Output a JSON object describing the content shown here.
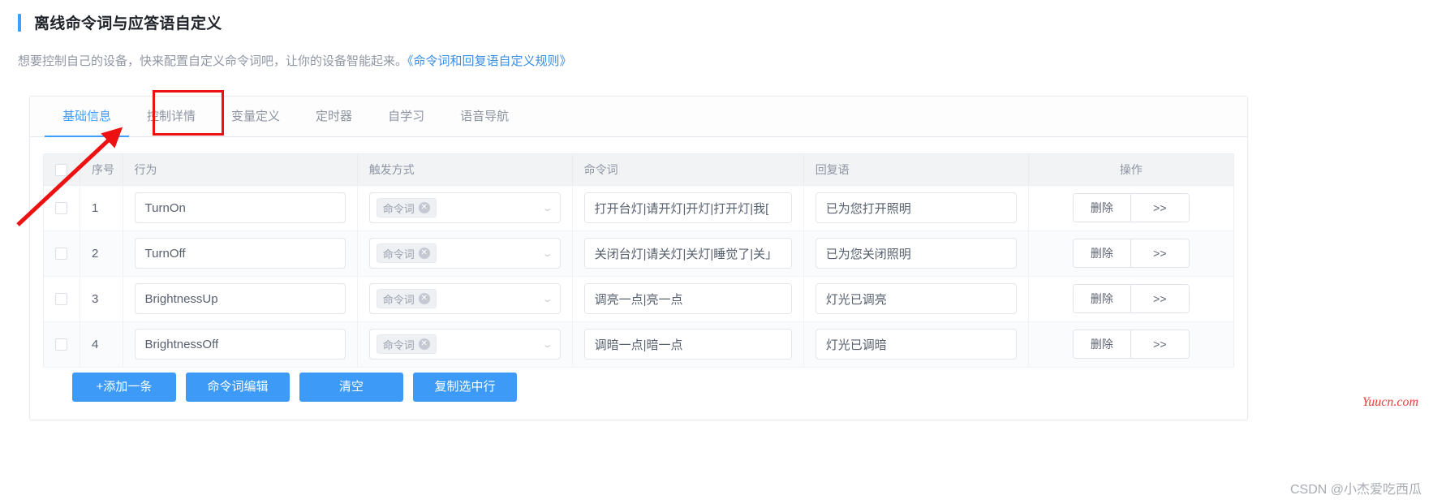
{
  "header": {
    "title": "离线命令词与应答语自定义",
    "description_prefix": "想要控制自己的设备，快来配置自定义命令词吧，让你的设备智能起来。",
    "description_link": "《命令词和回复语自定义规则》",
    "accent_color": "#409eff"
  },
  "tabs": [
    {
      "label": "基础信息",
      "active": true
    },
    {
      "label": "控制详情",
      "active": false
    },
    {
      "label": "变量定义",
      "active": false
    },
    {
      "label": "定时器",
      "active": false
    },
    {
      "label": "自学习",
      "active": false
    },
    {
      "label": "语音导航",
      "active": false
    }
  ],
  "annotation": {
    "color": "#ee1111",
    "target_tab": "控制详情"
  },
  "table": {
    "columns": [
      "",
      "序号",
      "行为",
      "触发方式",
      "命令词",
      "回复语",
      "操作"
    ],
    "rows": [
      {
        "index": "1",
        "action": "TurnOn",
        "trigger_tag": "命令词",
        "command": "打开台灯|请开灯|开灯|打开灯|我[",
        "reply": "已为您打开照明",
        "op_delete": "删除",
        "op_more": ">>"
      },
      {
        "index": "2",
        "action": "TurnOff",
        "trigger_tag": "命令词",
        "command": "关闭台灯|请关灯|关灯|睡觉了|关」",
        "reply": "已为您关闭照明",
        "op_delete": "删除",
        "op_more": ">>"
      },
      {
        "index": "3",
        "action": "BrightnessUp",
        "trigger_tag": "命令词",
        "command": "调亮一点|亮一点",
        "reply": "灯光已调亮",
        "op_delete": "删除",
        "op_more": ">>"
      },
      {
        "index": "4",
        "action": "BrightnessOff",
        "trigger_tag": "命令词",
        "command": "调暗一点|暗一点",
        "reply": "灯光已调暗",
        "op_delete": "删除",
        "op_more": ">>"
      }
    ]
  },
  "footer_buttons": [
    {
      "label": "+添加一条"
    },
    {
      "label": "命令词编辑"
    },
    {
      "label": "清空"
    },
    {
      "label": "复制选中行"
    }
  ],
  "watermarks": {
    "red": "Yuucn.com",
    "grey": "CSDN @小杰爱吃西瓜"
  }
}
